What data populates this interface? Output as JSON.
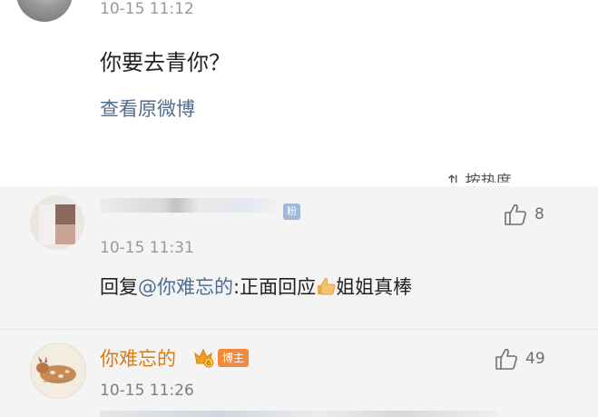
{
  "post": {
    "time": "10-15 11:12",
    "text": "你要去青你？",
    "view_original_label": "查看原微博",
    "sort_label": "按热度"
  },
  "comments": [
    {
      "time": "10-15 11:31",
      "badge": "粉",
      "likes": "8",
      "reply_prefix": "回复",
      "mention": "@你难忘的",
      "text_after_mention": ":正面回应",
      "text_after_emoji": "姐姐真棒"
    },
    {
      "name": "你难忘的",
      "badge": "博主",
      "likes": "49",
      "time": "10-15 11:26"
    }
  ],
  "icons": {
    "like": "thumbs-up-outline-icon",
    "emoji": "thumbs-up-emoji-icon",
    "vip": "vip-crown-icon"
  },
  "colors": {
    "link": "#506d8f",
    "username_highlight": "#e07a0f",
    "blogger_badge": "#f08a3c"
  }
}
